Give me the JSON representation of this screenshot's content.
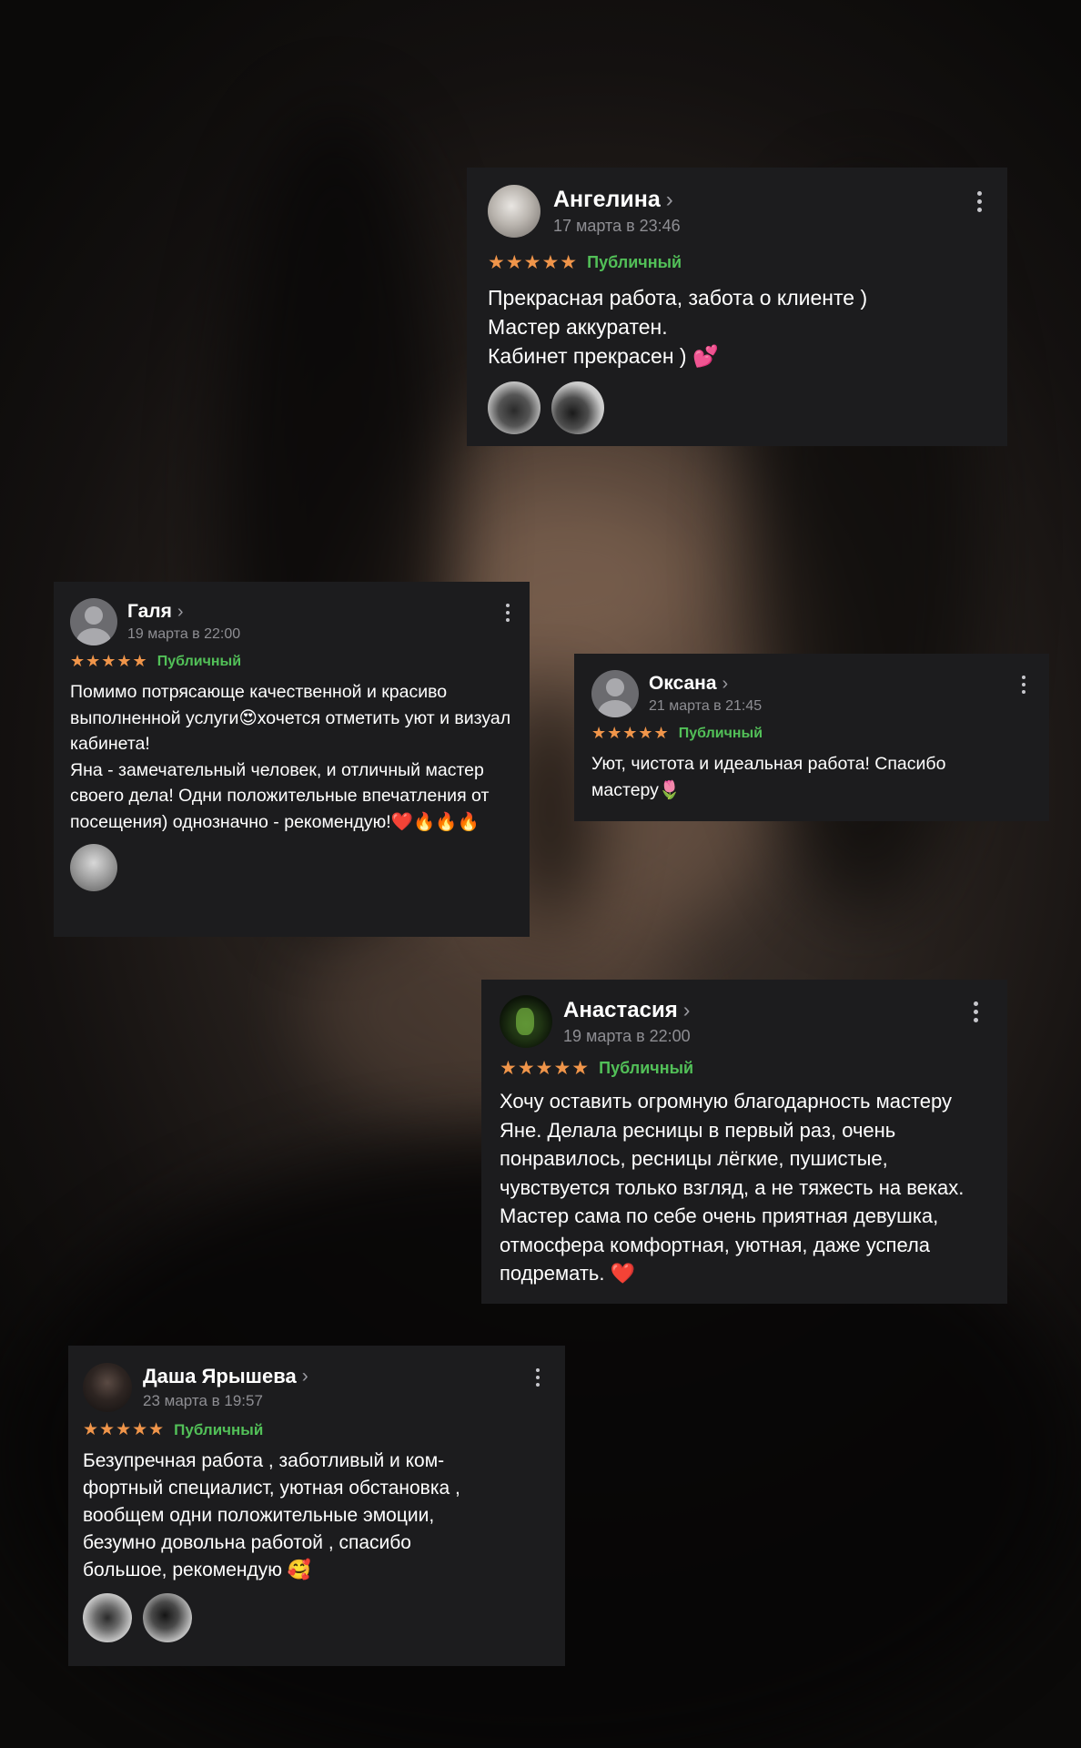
{
  "reviews": [
    {
      "name": "Ангелина",
      "date": "17 марта в 23:46",
      "stars": "★★★★★",
      "badge": "Публичный",
      "text": "Прекрасная работа, забота о клиенте )\nМастер аккуратен.\nКабинет прекрасен ) 💕",
      "photo_count": 2
    },
    {
      "name": "Галя",
      "date": "19 марта в 22:00",
      "stars": "★★★★★",
      "badge": "Публичный",
      "text": "Помимо потрясающе качественной и красиво выполненной услуги😍хочется отметить уют и визуал кабинета!\nЯна - замечательный человек, и отличный мастер своего дела! Одни положительные впечатления от посещения) однозначно - рекомендую!❤️🔥🔥🔥",
      "photo_count": 1
    },
    {
      "name": "Оксана",
      "date": "21 марта в 21:45",
      "stars": "★★★★★",
      "badge": "Публичный",
      "text": "Уют, чистота и идеальная работа! Спасибо мастеру🌷",
      "photo_count": 0
    },
    {
      "name": "Анастасия",
      "date": "19 марта в 22:00",
      "stars": "★★★★★",
      "badge": "Публичный",
      "text": "Хочу оставить огромную благодарность мастеру Яне. Делала ресницы в первый раз, очень понравилось, ресницы лёгкие, пушистые, чувствуется только взгляд, а не тяжесть на веках. Мастер сама по себе очень приятная девушка, отмосфера комфортная, уютная, даже успела подремать. ❤️",
      "photo_count": 0
    },
    {
      "name": "Даша Ярышева",
      "date": "23 марта в 19:57",
      "stars": "★★★★★",
      "badge": "Публичный",
      "text": "Безупречная работа , заботливый и ком-\nфортный специалист, уютная обстановка ,\nвообщем одни положительные эмоции,\nбезумно довольна работой , спасибо\nбольшое, рекомендую 🥰",
      "photo_count": 2
    }
  ],
  "icons": {
    "chevron": "chevron-right-icon",
    "menu": "more-vertical-icon",
    "star": "star-icon"
  },
  "colors": {
    "card_bg": "#1c1c1e",
    "star": "#f0954a",
    "badge": "#52c058",
    "date": "#8e8e93"
  }
}
